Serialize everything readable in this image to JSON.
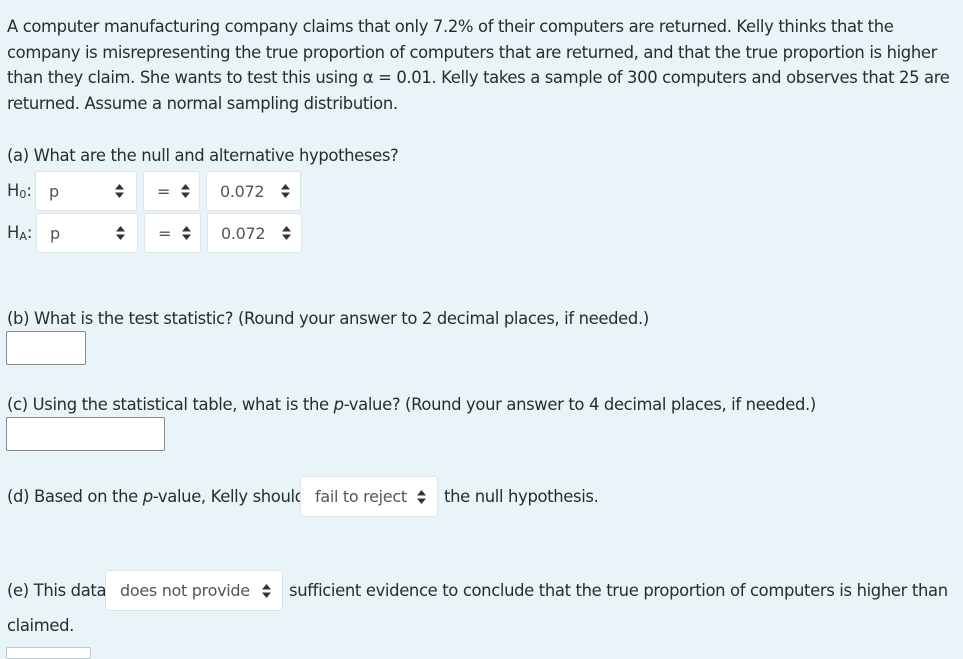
{
  "problem": {
    "intro": "A computer manufacturing company claims that only 7.2% of their computers are returned. Kelly thinks that the company is misrepresenting the true proportion of computers that are returned, and that the true proportion is higher than they claim. She wants to test this using α = 0.01. Kelly takes a sample of 300 computers and observes that 25 are returned. Assume a normal sampling distribution."
  },
  "part_a": {
    "question": "(a) What are the null and alternative hypotheses?",
    "h0": {
      "label_main": "H",
      "label_sub": "0",
      "colon": ":",
      "param": "p",
      "operator": "=",
      "value": "0.072"
    },
    "ha": {
      "label_main": "H",
      "label_sub": "A",
      "colon": ":",
      "param": "p",
      "operator": "=",
      "value": "0.072"
    }
  },
  "part_b": {
    "question": "(b) What is the test statistic? (Round your answer to 2 decimal places, if needed.)",
    "answer": ""
  },
  "part_c": {
    "question_prefix": "(c) Using the statistical table, what is the ",
    "question_italic": "p",
    "question_suffix": "-value? (Round your answer to 4 decimal places, if needed.)",
    "answer": ""
  },
  "part_d": {
    "prefix": "(d) Based on the ",
    "italic": "p",
    "middle": "-value, Kelly should",
    "selected": "fail to reject",
    "suffix": "the null hypothesis."
  },
  "part_e": {
    "prefix": "(e) This data",
    "selected": "does not provide",
    "suffix": "sufficient evidence to conclude that the true proportion of computers is higher than",
    "line2": "claimed."
  },
  "icons": {
    "select_arrow": "up-down-caret-icon"
  }
}
